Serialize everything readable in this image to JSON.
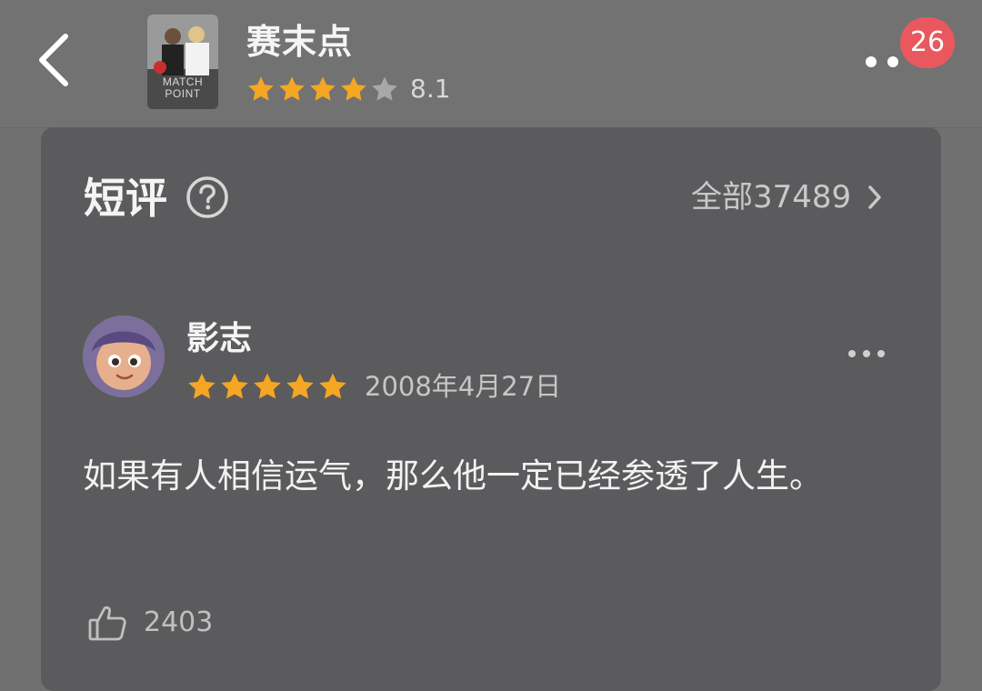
{
  "header": {
    "movie_title": "赛末点",
    "poster_text_line1": "MATCH",
    "poster_text_line2": "POINT",
    "rating_stars": 4,
    "rating_value": "8.1",
    "notification_count": "26"
  },
  "section": {
    "title": "短评",
    "all_link": "全部37489"
  },
  "comment": {
    "user_name": "影志",
    "stars": 5,
    "date": "2008年4月27日",
    "text": "如果有人相信运气，那么他一定已经参透了人生。",
    "like_count": "2403"
  },
  "colors": {
    "star_active": "#f5a623",
    "star_inactive": "#a8a8a8",
    "badge": "#e9585e"
  }
}
